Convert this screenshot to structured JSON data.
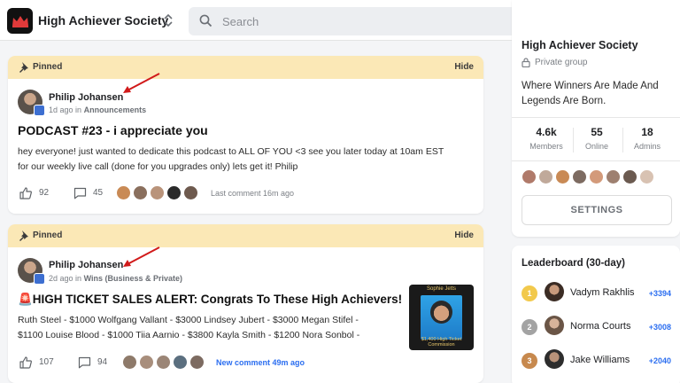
{
  "header": {
    "title": "High Achiever Society",
    "search_placeholder": "Search"
  },
  "icons": {
    "logo": "crown-logo",
    "switcher": "chevron-up-down-icon",
    "search": "search-icon",
    "chat": "chat-icon",
    "notifications": "bell-icon",
    "pin": "pin-icon",
    "like": "thumbs-up-icon",
    "comment": "comment-icon",
    "lock": "lock-icon"
  },
  "colors": {
    "pin_bar": "#fbe8b6",
    "accent_blue": "#2b6ef0",
    "arrow_red": "#d11a1a"
  },
  "posts": [
    {
      "pinned_label": "Pinned",
      "hide_label": "Hide",
      "author": "Philip Johansen",
      "time": "1d ago",
      "in_label": "in",
      "category": "Announcements",
      "title": "PODCAST #23 - i appreciate you",
      "body_line1": "hey everyone! just wanted to dedicate this podcast to ALL OF YOU <3 see you later today at 10am EST",
      "body_line2": "for our weekly live call (done for you upgrades only) lets get it! Philip",
      "likes": "92",
      "comments": "45",
      "activity": "Last comment 16m ago"
    },
    {
      "pinned_label": "Pinned",
      "hide_label": "Hide",
      "author": "Philip Johansen",
      "time": "2d ago",
      "in_label": "in",
      "category": "Wins (Business & Private)",
      "title": "🚨HIGH TICKET SALES ALERT: Congrats To These High Achievers!",
      "body_line1": "Ruth Steel - $1000 Wolfgang Vallant - $3000 Lindsey Jubert - $3000 Megan Stifel -",
      "body_line2": "$1100 Louise Blood - $1000 Tiia Aarnio - $3800 Kayla Smith - $1200 Nora Sonbol -",
      "likes": "107",
      "comments": "94",
      "activity": "New comment 49m ago",
      "thumbnail_top": "Sophie Jetts",
      "thumbnail_bottom": "$1,400 High Ticket Commission"
    }
  ],
  "group": {
    "name": "High Achiever Society",
    "type": "Private group",
    "description": "Where Winners Are Made And Legends Are Born.",
    "stats": [
      {
        "value": "4.6k",
        "label": "Members"
      },
      {
        "value": "55",
        "label": "Online"
      },
      {
        "value": "18",
        "label": "Admins"
      }
    ],
    "settings_label": "SETTINGS"
  },
  "leaderboard": {
    "title": "Leaderboard (30-day)",
    "entries": [
      {
        "rank": "1",
        "name": "Vadym Rakhlis",
        "points": "+3394"
      },
      {
        "rank": "2",
        "name": "Norma Courts",
        "points": "+3008"
      },
      {
        "rank": "3",
        "name": "Jake Williams",
        "points": "+2040"
      }
    ]
  }
}
